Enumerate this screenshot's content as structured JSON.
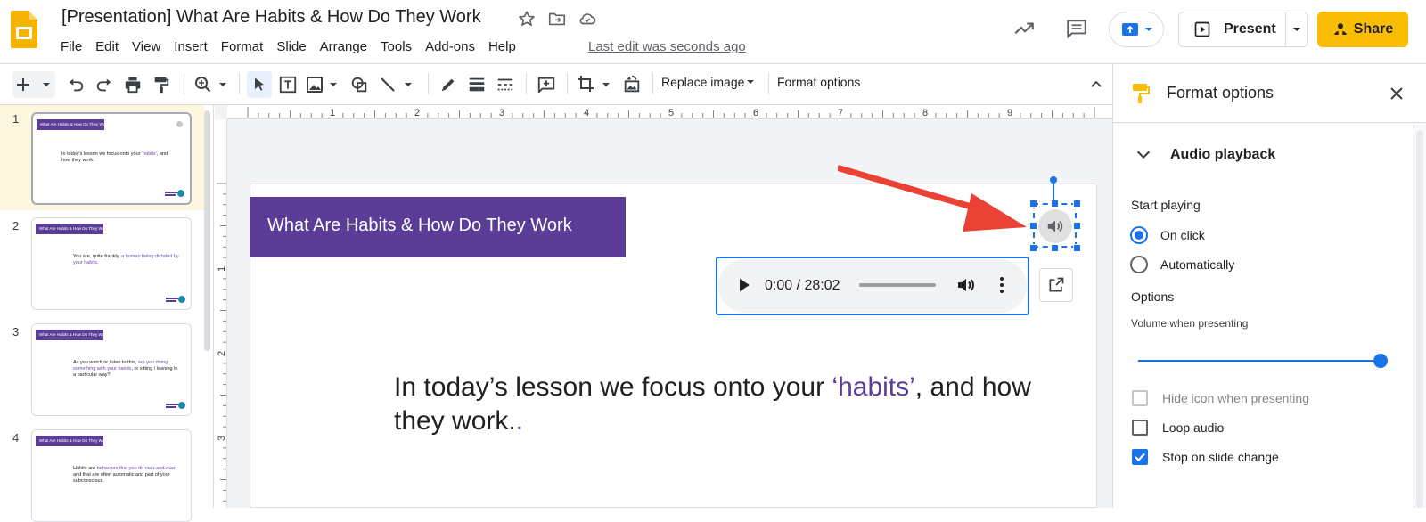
{
  "header": {
    "doc_title": "[Presentation] What Are Habits & How Do They Work",
    "menus": [
      "File",
      "Edit",
      "View",
      "Insert",
      "Format",
      "Slide",
      "Arrange",
      "Tools",
      "Add-ons",
      "Help"
    ],
    "last_edit": "Last edit was seconds ago",
    "present_label": "Present",
    "share_label": "Share"
  },
  "toolbar": {
    "replace_image": "Replace image",
    "format_options": "Format options"
  },
  "ruler": {
    "h": [
      "1",
      "2",
      "3",
      "4",
      "5",
      "6",
      "7",
      "8",
      "9"
    ],
    "v": [
      "1",
      "2",
      "3"
    ]
  },
  "filmstrip": {
    "slides": [
      {
        "num": "1",
        "title": "What Are Habits & How Do They Work",
        "text_a": "In today's lesson we focus onto your ",
        "text_hl": "'habits'",
        "text_b": ", and how they work."
      },
      {
        "num": "2",
        "title": "What Are Habits & How Do They Work",
        "text_a": "You are, quite frankly, ",
        "text_hl": "a human being dictated by your habits",
        "text_b": "."
      },
      {
        "num": "3",
        "title": "What Are Habits & How Do They Work",
        "text_a": "As you watch or listen to this, ",
        "text_hl": "are you doing something with your hands",
        "text_b": ", or sitting / leaning in a particular way?"
      },
      {
        "num": "4",
        "title": "What Are Habits & How Do They Work",
        "text_a": "Habits are ",
        "text_hl": "behaviors that you do over-and-over",
        "text_b": ", and that are often automatic and part of your subconscious."
      }
    ]
  },
  "slide": {
    "title": "What Are Habits & How Do They Work",
    "body_a": "In today’s lesson we focus onto your ",
    "body_hl": "‘habits’",
    "body_b": ", and how they work",
    "body_dot1": ".",
    "body_dot2": "."
  },
  "audio_player": {
    "time": "0:00 / 28:02",
    "progress_fraction": 0
  },
  "panel": {
    "title": "Format options",
    "section": "Audio playback",
    "start_playing": "Start playing",
    "on_click": "On click",
    "automatically": "Automatically",
    "options": "Options",
    "volume_label": "Volume when presenting",
    "volume_fraction": 1.0,
    "hide_icon": "Hide icon when presenting",
    "loop_audio": "Loop audio",
    "stop_on_change": "Stop on slide change",
    "selected_start": "On click",
    "checks": {
      "hide_icon": false,
      "loop_audio": false,
      "stop_on_change": true
    }
  },
  "colors": {
    "accent_blue": "#1a73e8",
    "slide_purple": "#5b3c96",
    "share_yellow": "#fbbc04",
    "arrow_red": "#ea4335",
    "slides_logo_yellow": "#f4b400"
  }
}
